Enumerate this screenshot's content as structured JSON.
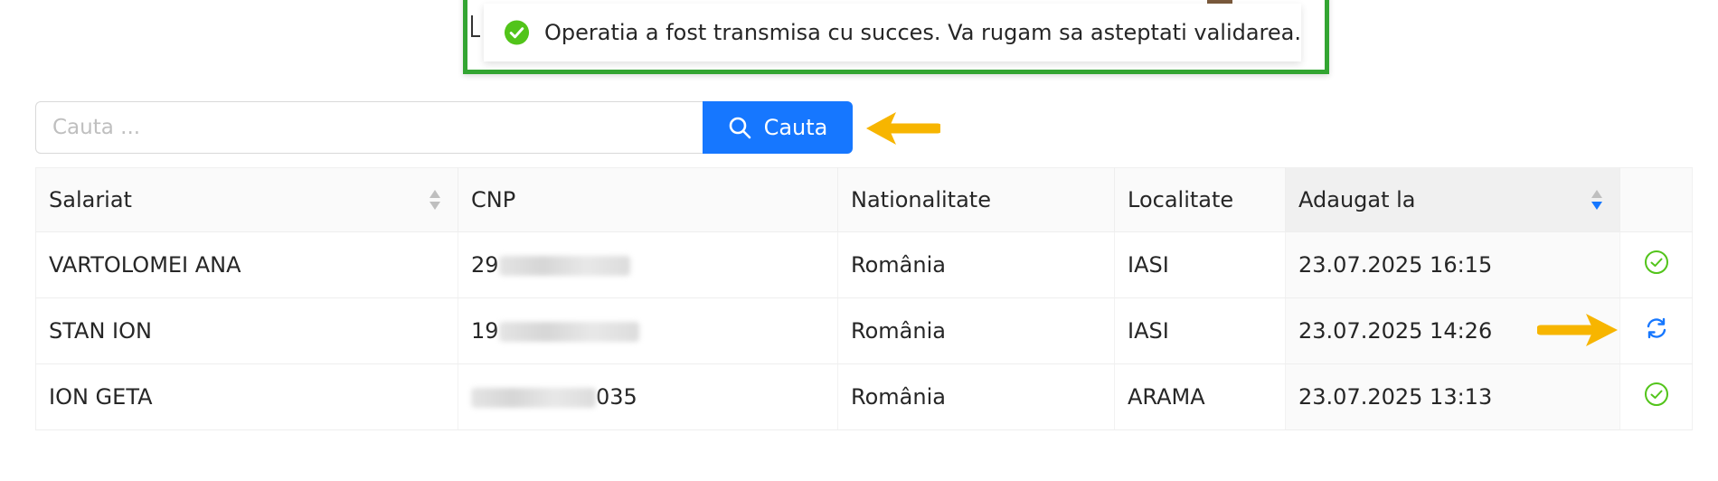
{
  "notification": {
    "message": "Operatia a fost transmisa cu succes. Va rugam sa asteptati validarea.",
    "icon": "check-circle-icon",
    "frame_color": "#33a532"
  },
  "search": {
    "placeholder": "Cauta ...",
    "value": "",
    "button_label": "Cauta",
    "button_color": "#1677ff"
  },
  "table": {
    "columns": [
      "Salariat",
      "CNP",
      "Nationalitate",
      "Localitate",
      "Adaugat la",
      ""
    ],
    "rows": [
      {
        "salariat": "VARTOLOMEI ANA",
        "cnp_prefix": "29",
        "cnp_suffix": "",
        "nationalitate": "România",
        "localitate": "IASI",
        "adaugat": "23.07.2025 16:15",
        "status": "validated"
      },
      {
        "salariat": "STAN ION",
        "cnp_prefix": "19",
        "cnp_suffix": "",
        "nationalitate": "România",
        "localitate": "IASI",
        "adaugat": "23.07.2025 14:26",
        "status": "pending"
      },
      {
        "salariat": "ION GETA",
        "cnp_prefix": "",
        "cnp_suffix": "035",
        "nationalitate": "România",
        "localitate": "ARAMA",
        "adaugat": "23.07.2025 13:13",
        "status": "validated"
      }
    ]
  },
  "colors": {
    "success": "#52c41a",
    "pending": "#1677ff",
    "annotation_arrow": "#f7b500"
  }
}
